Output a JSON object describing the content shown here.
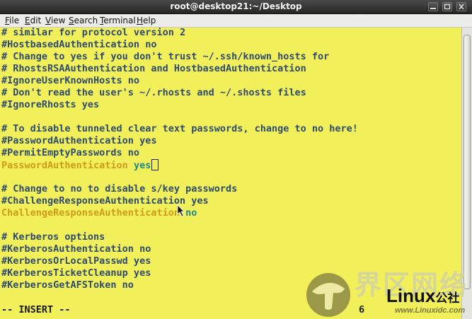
{
  "window": {
    "title": "root@desktop21:~/Desktop"
  },
  "menubar": {
    "items": [
      {
        "accel": "F",
        "rest": "ile"
      },
      {
        "accel": "E",
        "rest": "dit"
      },
      {
        "accel": "V",
        "rest": "iew"
      },
      {
        "accel": "S",
        "rest": "earch"
      },
      {
        "accel": "T",
        "rest": "erminal"
      },
      {
        "accel": "H",
        "rest": "elp"
      }
    ]
  },
  "editor": {
    "lines": [
      "# similar for protocol version 2",
      "#HostbasedAuthentication no",
      "# Change to yes if you don't trust ~/.ssh/known_hosts for",
      "# RhostsRSAAuthentication and HostbasedAuthentication",
      "#IgnoreUserKnownHosts no",
      "# Don't read the user's ~/.rhosts and ~/.shosts files",
      "#IgnoreRhosts yes",
      "",
      "# To disable tunneled clear text passwords, change to no here!",
      "#PasswordAuthentication yes",
      "#PermitEmptyPasswords no",
      "",
      "",
      "# Change to no to disable s/key passwords",
      "#ChallengeResponseAuthentication yes",
      "",
      "",
      "# Kerberos options",
      "#KerberosAuthentication no",
      "#KerberosOrLocalPasswd yes",
      "#KerberosTicketCleanup yes",
      "#KerberosGetAFSToken no"
    ],
    "active_option_1": {
      "key": "PasswordAuthentication",
      "value": "yes"
    },
    "active_option_2": {
      "key": "ChallengeResponseAuthentication",
      "value": "no"
    },
    "mode": "-- INSERT --",
    "position_partial": "6"
  },
  "watermark": {
    "cn": "界区网络",
    "brand_main": "Linux",
    "brand_suffix": "公社",
    "site": "www.Linuxidc.com"
  },
  "colors": {
    "terminal_bg": "#f2f05a",
    "comment_text": "#2e4a6e",
    "option_key": "#d19a18",
    "option_value": "#1b8a8a"
  }
}
